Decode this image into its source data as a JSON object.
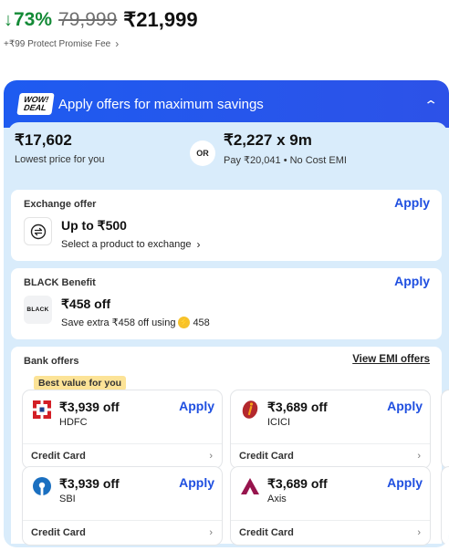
{
  "price": {
    "discount": "73%",
    "mrp": "79,999",
    "sale": "₹21,999",
    "fee": "+₹99 Protect Promise Fee"
  },
  "banner": {
    "badge_top": "WOW!",
    "badge_bottom": "DEAL",
    "title": "Apply offers for maximum savings"
  },
  "best": {
    "lowest_amount": "₹17,602",
    "lowest_label": "Lowest price for you",
    "or": "OR",
    "emi_amount": "₹2,227 x 9m",
    "emi_label": "Pay ₹20,041 • No Cost EMI"
  },
  "exchange": {
    "title": "Exchange offer",
    "apply": "Apply",
    "heading": "Up to ₹500",
    "sub": "Select a product to exchange"
  },
  "black": {
    "title": "BLACK Benefit",
    "apply": "Apply",
    "logo": "BLACK",
    "heading": "₹458 off",
    "sub": "Save extra ₹458 off using",
    "coins": "458"
  },
  "bank": {
    "title": "Bank offers",
    "view_emi": "View EMI offers",
    "best_tag": "Best value for you",
    "offers": [
      {
        "amount": "₹3,939 off",
        "bank": "HDFC",
        "apply": "Apply",
        "type": "Credit Card",
        "color": "#d31f26"
      },
      {
        "amount": "₹3,689 off",
        "bank": "ICICI",
        "apply": "Apply",
        "type": "Credit Card",
        "color": "#b3282d"
      },
      {
        "amount": "₹3,939 off",
        "bank": "SBI",
        "apply": "Apply",
        "type": "Credit Card",
        "color": "#1a6fc0"
      },
      {
        "amount": "₹3,689 off",
        "bank": "Axis",
        "apply": "Apply",
        "type": "Credit Card",
        "color": "#97144d"
      }
    ]
  }
}
